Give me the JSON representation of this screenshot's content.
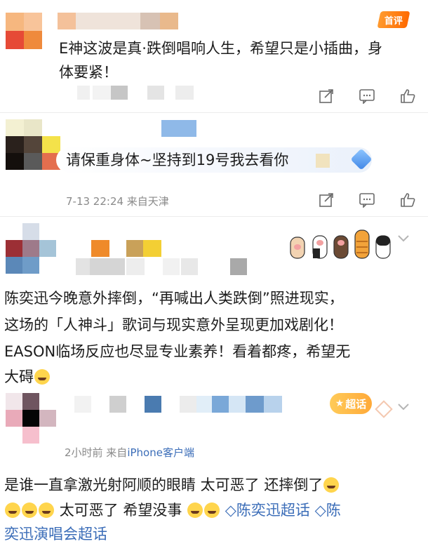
{
  "comment1": {
    "badge": "首评",
    "text": "E神这波是真·跌倒唱响人生，希望只是小插曲，身体要紧！"
  },
  "comment2": {
    "text": "请保重身体~坚持到19号我去看你",
    "meta": "7-13 22:24 来自天津"
  },
  "comment3": {
    "text_line1": "陈奕迅今晚意外摔倒，“再喊出人类跌倒”照进现实，",
    "text_line2": "这场的「人神斗」歌词与现实意外呈现更加戏剧化！",
    "text_line3": "EASON临场反应也尽显专业素养！看着都疼，希望无",
    "text_line4": "大碍"
  },
  "comment4": {
    "badge": "超话",
    "meta": "2小时前  来自",
    "meta_link": "iPhone客户端"
  },
  "comment5": {
    "line1": "是谁一直拿激光射阿顺的眼睛 太可恶了 还摔倒了",
    "line2_text": "太可恶了 希望没事",
    "tag1": "陈奕迅超话",
    "tag2_head": "陈",
    "tag2_tail": "奕迅演唱会超话"
  },
  "icons": {
    "share": "share-icon",
    "comment": "comment-icon",
    "like": "like-icon",
    "chevron": "chevron-down-icon"
  },
  "colors": {
    "accent_orange": "#ff8200",
    "tag_blue": "#3b6db8",
    "meta_gray": "#8a8a8a"
  }
}
